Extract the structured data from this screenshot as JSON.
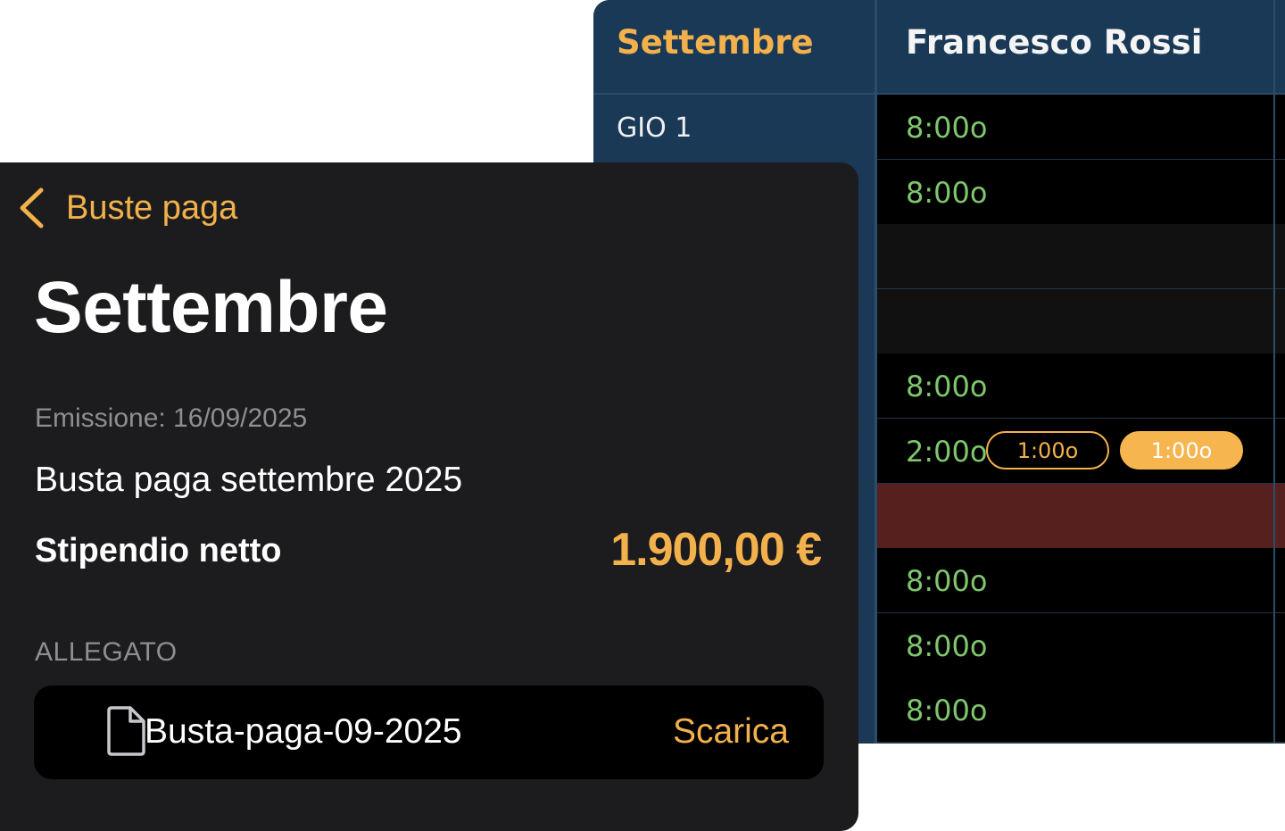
{
  "schedule": {
    "month": "Settembre",
    "employee": "Francesco Rossi",
    "rows": [
      {
        "day": "GIO 1",
        "hours": "8:00o",
        "type": "work"
      },
      {
        "day": "",
        "hours": "8:00o",
        "type": "work"
      },
      {
        "day": "",
        "hours": "",
        "type": "empty"
      },
      {
        "day": "",
        "hours": "",
        "type": "empty"
      },
      {
        "day": "",
        "hours": "8:00o",
        "type": "work"
      },
      {
        "day": "",
        "hours": "2:00o",
        "type": "work",
        "pills": [
          "1:00o",
          "1:00o"
        ]
      },
      {
        "day": "",
        "hours": "",
        "type": "absent"
      },
      {
        "day": "",
        "hours": "8:00o",
        "type": "work"
      },
      {
        "day": "",
        "hours": "8:00o",
        "type": "work"
      },
      {
        "day": "",
        "hours": "8:00o",
        "type": "work"
      }
    ],
    "colors": {
      "header_bg": "#1a3956",
      "accent": "#f2b14c",
      "hours_text": "#7fc66c",
      "absent_bg": "#55201e"
    }
  },
  "payslip": {
    "back_label": "Buste paga",
    "title": "Settembre",
    "issue_date": "Emissione: 16/09/2025",
    "document_title": "Busta paga settembre 2025",
    "net_label": "Stipendio netto",
    "net_value": "1.900,00 €",
    "attachment_section": "ALLEGATO",
    "attachment": {
      "icon": "document-icon",
      "file_name": "Busta-paga-09-2025",
      "action_label": "Scarica"
    },
    "colors": {
      "card_bg": "#1c1c1e",
      "accent": "#f2b14c"
    }
  }
}
